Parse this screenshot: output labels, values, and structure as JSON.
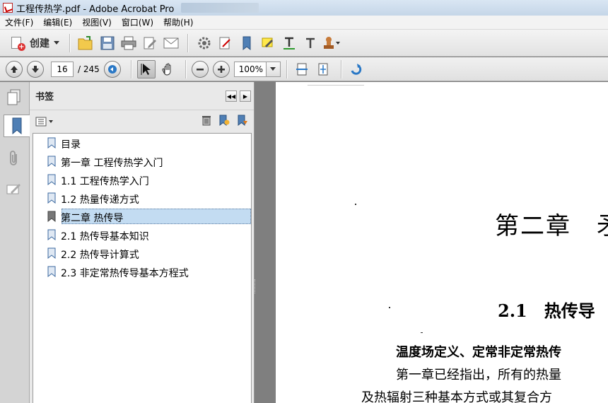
{
  "window": {
    "title": "工程传热学.pdf - Adobe Acrobat Pro"
  },
  "menu": [
    "文件(F)",
    "编辑(E)",
    "视图(V)",
    "窗口(W)",
    "帮助(H)"
  ],
  "toolbar": {
    "create_label": "创建",
    "icons": [
      "open-icon",
      "save-icon",
      "print-icon",
      "edit-icon",
      "email-icon",
      "settings-icon",
      "sign-icon",
      "bookmark-add-icon",
      "highlight-icon",
      "text-underline-icon",
      "text-icon",
      "stamp-icon"
    ]
  },
  "nav": {
    "current_page": "16",
    "total_pages": "/ 245",
    "zoom": "100%"
  },
  "panel": {
    "title": "书签",
    "bookmarks": [
      {
        "label": "目录"
      },
      {
        "label": "第一章 工程传热学入门"
      },
      {
        "label": "1.1 工程传热学入门"
      },
      {
        "label": "1.2 热量传递方式"
      },
      {
        "label": "第二章 热传导"
      },
      {
        "label": "2.1 热传导基本知识"
      },
      {
        "label": "2.2 热传导计算式"
      },
      {
        "label": "2.3 非定常热传导基本方程式"
      }
    ],
    "selected_index": 4
  },
  "document": {
    "chapter_heading": "第二章　矛",
    "section_heading": "2.1　热传导",
    "lines": [
      "温度场定义、定常非定常热传",
      "第一章已经指出，所有的热量",
      "及热辐射三种基本方式或其复合方"
    ]
  },
  "colors": {
    "selection": "#c3dcf2",
    "accent_red": "#cc0000"
  }
}
